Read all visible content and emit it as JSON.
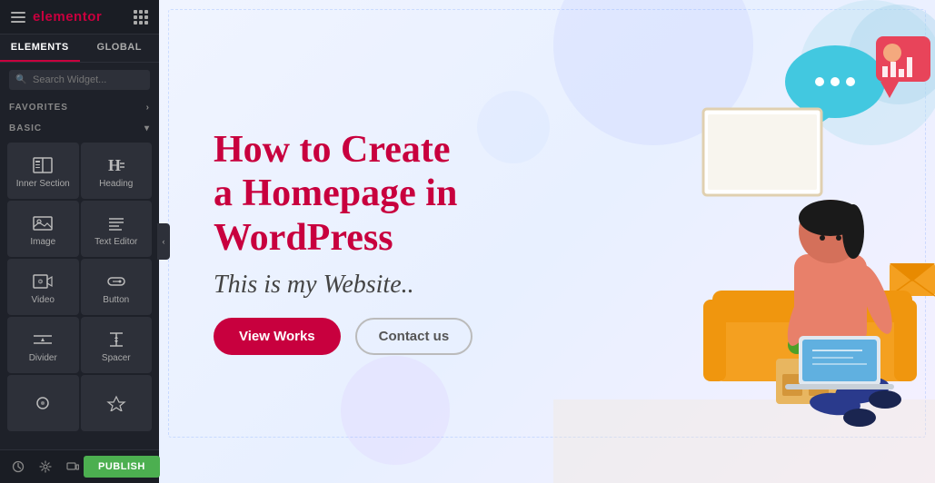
{
  "header": {
    "logo": "elementor",
    "tabs": [
      "ELEMENTS",
      "GLOBAL"
    ]
  },
  "sidebar": {
    "search_placeholder": "Search Widget...",
    "sections": [
      {
        "label": "FAVORITES",
        "collapsible": true,
        "arrow": "›"
      },
      {
        "label": "BASIC",
        "collapsible": true,
        "arrow": "▾"
      }
    ],
    "widgets": [
      {
        "id": "inner-section",
        "label": "Inner Section",
        "icon": "inner-section"
      },
      {
        "id": "heading",
        "label": "Heading",
        "icon": "heading"
      },
      {
        "id": "image",
        "label": "Image",
        "icon": "image"
      },
      {
        "id": "text-editor",
        "label": "Text Editor",
        "icon": "text-editor"
      },
      {
        "id": "video",
        "label": "Video",
        "icon": "video"
      },
      {
        "id": "button",
        "label": "Button",
        "icon": "button"
      },
      {
        "id": "divider",
        "label": "Divider",
        "icon": "divider"
      },
      {
        "id": "spacer",
        "label": "Spacer",
        "icon": "spacer"
      },
      {
        "id": "icon-w1",
        "label": "",
        "icon": "icon1"
      },
      {
        "id": "icon-w2",
        "label": "",
        "icon": "icon2"
      }
    ],
    "publish_label": "PUBLISH",
    "collapse_arrow": "‹"
  },
  "canvas": {
    "title_line1": "How to Create",
    "title_line2": "a Homepage in",
    "title_line3": "WordPress",
    "subtitle": "This is my Website..",
    "button_primary": "View Works",
    "button_secondary": "Contact us"
  }
}
